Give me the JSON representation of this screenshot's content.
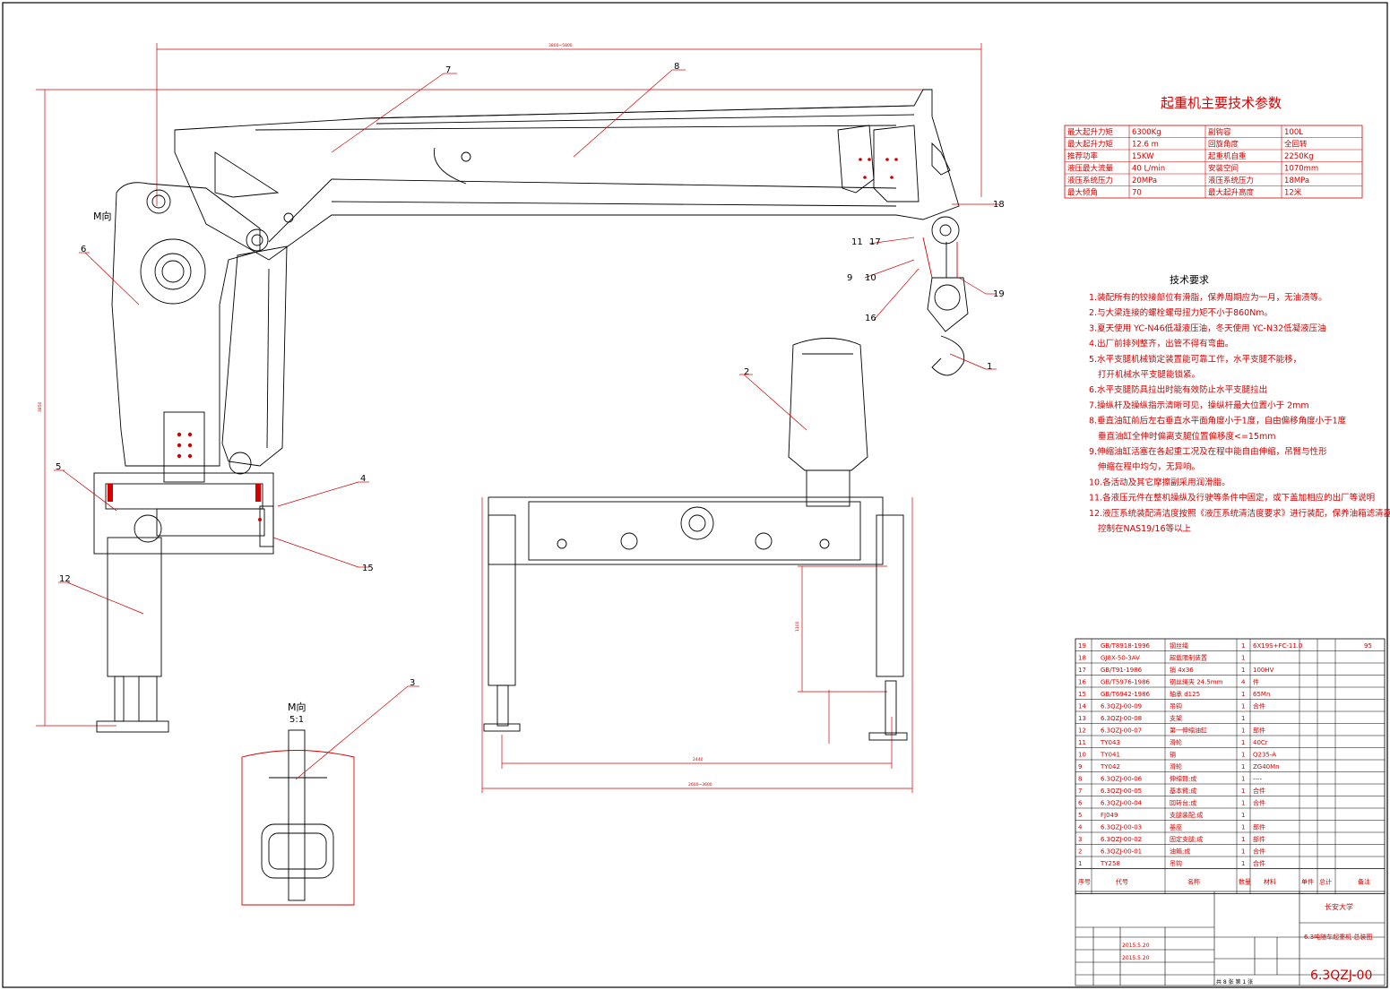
{
  "specs": {
    "title": "起重机主要技术参数",
    "rows": [
      [
        "最大起升力矩",
        "6300Kg",
        "副钩容",
        "100L"
      ],
      [
        "最大起升力矩",
        "12.6 m",
        "回旋角度",
        "全回转"
      ],
      [
        "推荐功率",
        "15KW",
        "起重机自重",
        "2250Kg"
      ],
      [
        "液压最大流量",
        "40 L/min",
        "安装空间",
        "1070mm"
      ],
      [
        "液压系统压力",
        "20MPa",
        "液压系统压力",
        "18MPa"
      ],
      [
        "最大倾角",
        "70",
        "最大起升高度",
        "12米"
      ]
    ]
  },
  "requirements": {
    "title": "技术要求",
    "items": [
      "1.装配所有的铰接部位有滑脂，保养周期应为一月，无油渍等。",
      "2.与大梁连接的螺栓螺母扭力矩不小于860Nm。",
      "3.夏天使用 YC-N46低凝液压油，冬天使用 YC-N32低凝液压油",
      "4.出厂前排列整齐，出管不得有弯曲。",
      "5.水平支腿机械锁定装置能可靠工作，水平支腿不能移，",
      "打开机械水平支腿能锁紧。",
      "6.水平支腿防具拉出时能有效防止水平支腿拉出",
      "7.操纵杆及操纵指示清晰可见，操纵杆最大位置小于 2mm",
      "8.垂直油缸前后左右垂直水平面角度小于1度，自由偏移角度小于1度",
      "垂直油缸全伸时偏离支腿位置偏移度<=15mm",
      "9.伸缩油缸活塞在各起重工况及在程中能自由伸缩，吊臂与性形",
      "伸缩在程中均匀，无异响。",
      "10.各活动及其它摩擦副采用润滑脂。",
      "11.各液压元件在整机操纵及行驶等条件中固定，或下盖加相应的出厂等说明",
      "12.液压系统装配清洁度按照《液压系统清洁度要求》进行装配，保养油箱滤清器",
      "控制在NAS19/16等以上"
    ]
  },
  "labels": {
    "dim_top": "3800~5800",
    "dim_left": "3850",
    "dim_base_inner": "2440",
    "dim_base_outer": "2600~3600",
    "dim_leg": "1100",
    "view_m_top": "M向",
    "view_m_detail": "M向",
    "view_scale": "5:1",
    "callouts": [
      "1",
      "2",
      "3",
      "4",
      "5",
      "6",
      "7",
      "8",
      "9",
      "10",
      "11",
      "12",
      "15",
      "16",
      "17",
      "18",
      "19"
    ]
  },
  "bom": {
    "rows": [
      [
        "19",
        "GB/T8918-1996",
        "钢丝绳",
        "1",
        "6X19S+FC-11.0",
        "",
        "95"
      ],
      [
        "18",
        "GJ8X-50-3AV",
        "超载限制装置",
        "1",
        "",
        "",
        ""
      ],
      [
        "17",
        "GB/T91-1986",
        "销 4x36",
        "1",
        "100HV",
        "",
        ""
      ],
      [
        "16",
        "GB/T5976-1986",
        "钢丝绳夹 24.5mm",
        "4",
        "件",
        "",
        ""
      ],
      [
        "15",
        "GB/T6942-1986",
        "轴承 d125",
        "1",
        "65Mn",
        "",
        ""
      ],
      [
        "14",
        "6.3QZJ-00-09",
        "吊钩",
        "1",
        "合件",
        "",
        ""
      ],
      [
        "13",
        "6.3QZJ-00-08",
        "支架",
        "1",
        "",
        "",
        ""
      ],
      [
        "12",
        "6.3QZJ-00-07",
        "第一伸缩油缸",
        "1",
        "部件",
        "",
        ""
      ],
      [
        "11",
        "TY043",
        "滑轮",
        "1",
        "40Cr",
        "",
        ""
      ],
      [
        "10",
        "TY041",
        "销",
        "1",
        "Q235-A",
        "",
        ""
      ],
      [
        "9",
        "TY042",
        "滑轮",
        "1",
        "ZG40Mn",
        "",
        ""
      ],
      [
        "8",
        "6.3QZJ-00-06",
        "伸缩臂;成",
        "1",
        "----",
        "",
        ""
      ],
      [
        "7",
        "6.3QZJ-00-05",
        "基本臂;成",
        "1",
        "合件",
        "",
        ""
      ],
      [
        "6",
        "6.3QZJ-00-04",
        "回转台;成",
        "1",
        "合件",
        "",
        ""
      ],
      [
        "5",
        "FJ049",
        "支腿装配;成",
        "1",
        "",
        "",
        ""
      ],
      [
        "4",
        "6.3QZJ-00-03",
        "基座",
        "1",
        "部件",
        "",
        ""
      ],
      [
        "3",
        "6.3QZJ-00-02",
        "固定支腿;成",
        "1",
        "部件",
        "",
        ""
      ],
      [
        "2",
        "6.3QZJ-00-01",
        "油箱;成",
        "1",
        "合件",
        "",
        ""
      ],
      [
        "1",
        "TY258",
        "吊钩",
        "1",
        "合件",
        "",
        ""
      ]
    ],
    "header": [
      "序号",
      "代号",
      "名称",
      "数量",
      "材料",
      "单件",
      "总计",
      "备注"
    ]
  },
  "titleblock": {
    "school": "长安大学",
    "name": "6.3吨随车起重机 总装图",
    "drawing_no": "6.3QZJ-00",
    "date1": "2015.5.20",
    "date2": "2015.5.20",
    "sheet": "共 8 张 第 1 张"
  }
}
